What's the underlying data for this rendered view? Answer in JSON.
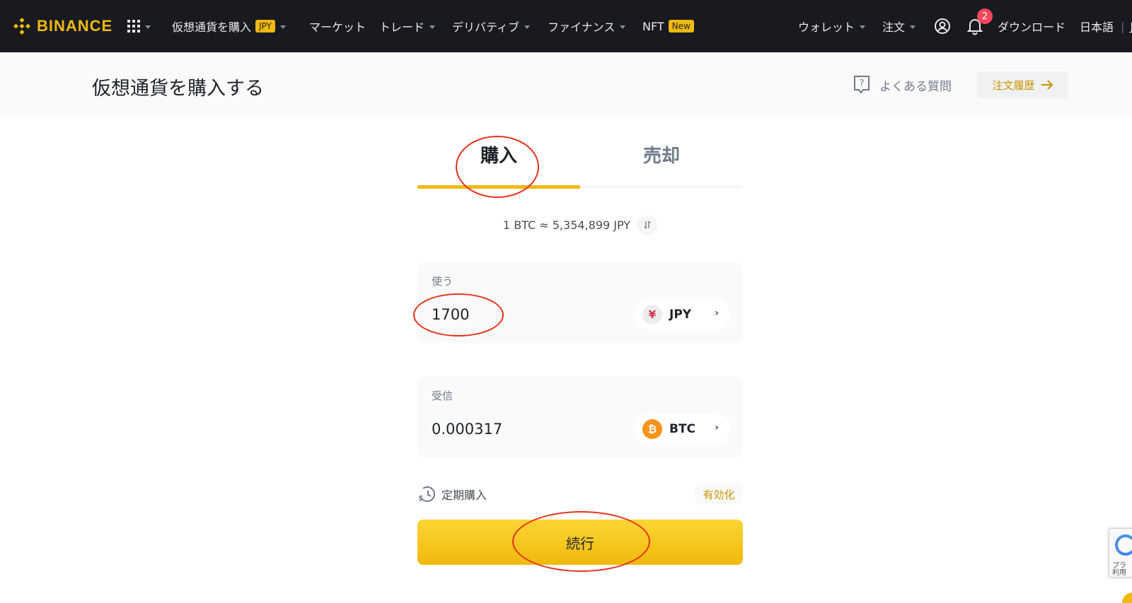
{
  "nav": {
    "logo_text": "BINANCE",
    "buy_crypto_label": "仮想通貨を購入",
    "buy_crypto_badge": "JPY",
    "markets_label": "マーケット",
    "trade_label": "トレード",
    "derivatives_label": "デリバティブ",
    "finance_label": "ファイナンス",
    "nft_label": "NFT",
    "nft_badge": "New",
    "wallet_label": "ウォレット",
    "orders_label": "注文",
    "notification_count": "2",
    "download_label": "ダウンロード",
    "language_label": "日本語",
    "separator": "|",
    "currency_cut": "J"
  },
  "header": {
    "title": "仮想通貨を購入する",
    "faq_label": "よくある質問",
    "order_history_label": "注文履歴"
  },
  "tabs": {
    "buy_label": "購入",
    "sell_label": "売却",
    "active": "buy"
  },
  "rate": {
    "text": "1 BTC ≈ 5,354,899 JPY"
  },
  "spend": {
    "label": "使う",
    "value": "1700",
    "currency_symbol": "¥",
    "currency": "JPY"
  },
  "receive": {
    "label": "受信",
    "value": "0.000317",
    "currency_symbol": "₿",
    "currency": "BTC"
  },
  "recurring": {
    "label": "定期購入",
    "enable_label": "有効化"
  },
  "continue_label": "続行",
  "recaptcha": {
    "text_line1": "プラ",
    "text_line2": "利用"
  },
  "colors": {
    "brand": "#f0b90b",
    "nav_bg": "#181a20",
    "annotation": "#e8301c",
    "accent_text": "#c99400"
  },
  "icons": {
    "logo": "binance-logo-icon",
    "apps": "grid-icon",
    "profile": "user-circle-icon",
    "notifications": "bell-icon",
    "faq": "question-icon",
    "arrow": "arrow-right-icon",
    "swap": "swap-icon",
    "recurring": "dollar-clock-icon"
  }
}
